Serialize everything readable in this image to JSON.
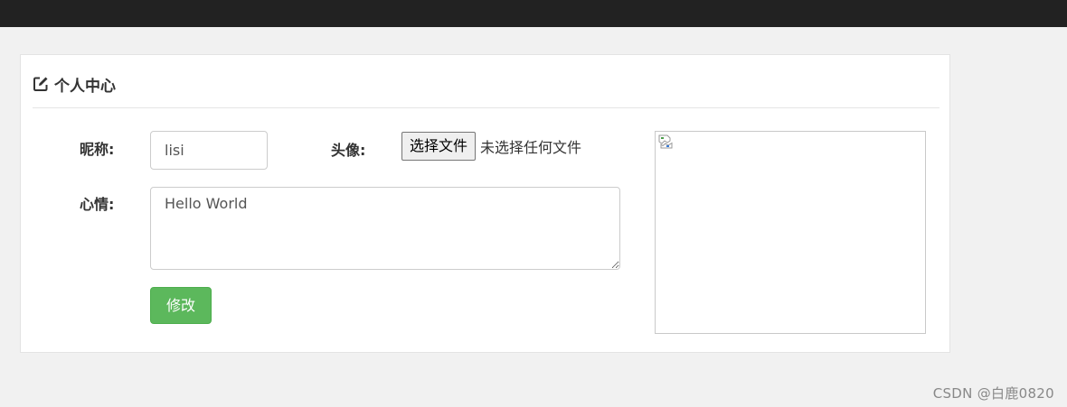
{
  "panel": {
    "title": "个人中心",
    "icon": "edit-icon"
  },
  "form": {
    "nickname_label": "昵称:",
    "nickname_value": "lisi",
    "avatar_label": "头像:",
    "file_button_label": "选择文件",
    "file_status": "未选择任何文件",
    "mood_label": "心情:",
    "mood_value": "Hello World",
    "submit_label": "修改"
  },
  "preview": {
    "icon": "broken-image-icon"
  },
  "watermark": "CSDN @白鹿0820",
  "colors": {
    "topbar": "#222222",
    "page_background": "#f1f1f1",
    "submit_button": "#5cb85c"
  }
}
